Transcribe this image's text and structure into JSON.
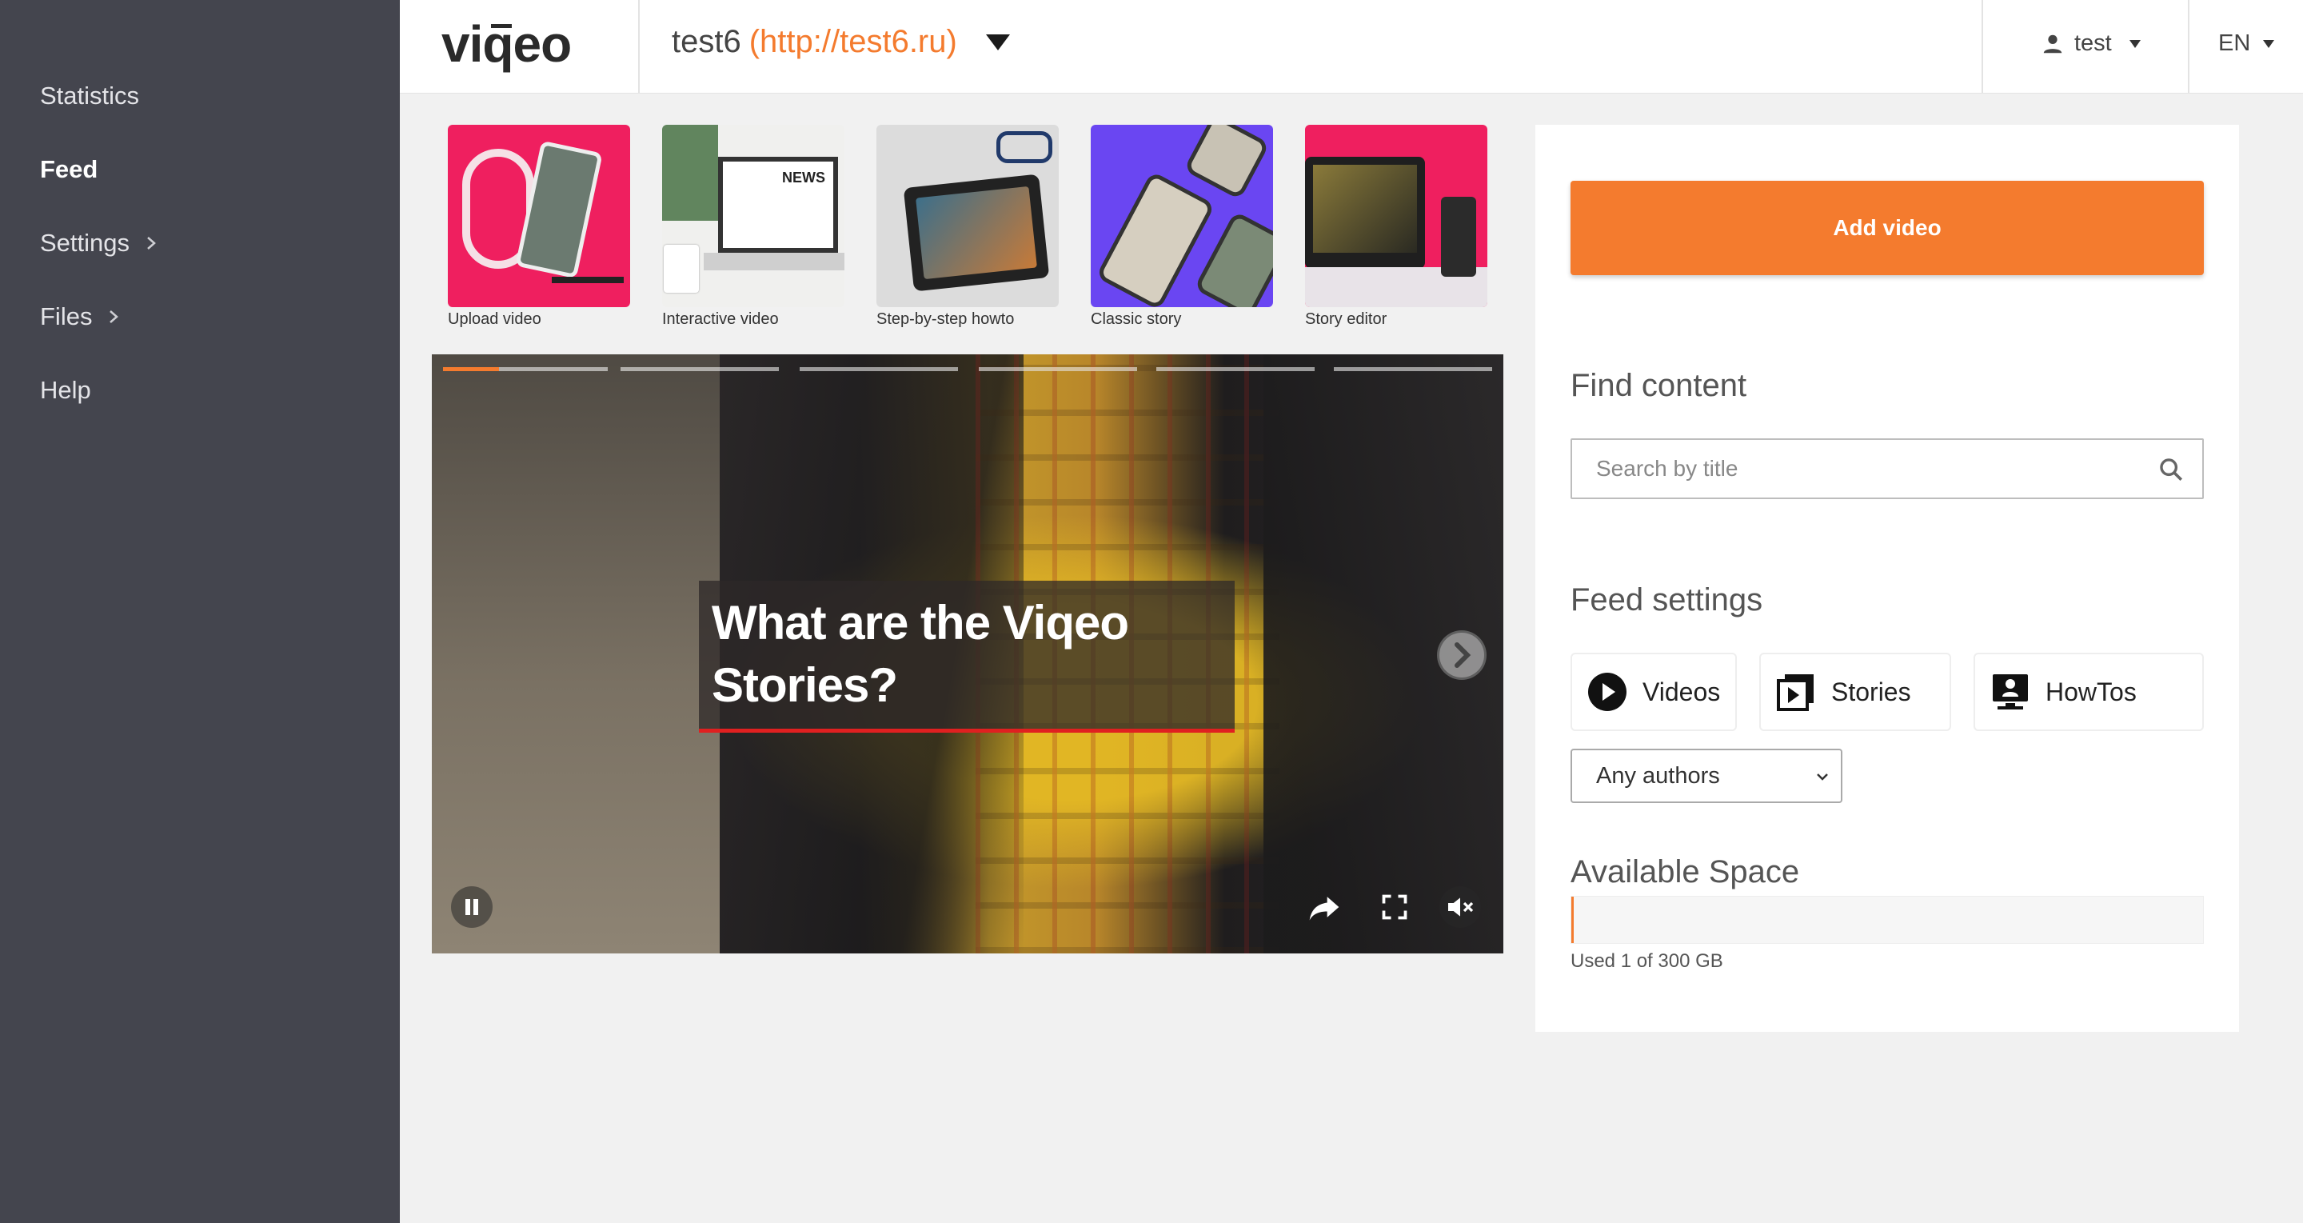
{
  "app": {
    "logo": "viqeo"
  },
  "sidebar": {
    "items": [
      {
        "label": "Statistics",
        "active": false,
        "has_submenu": false
      },
      {
        "label": "Feed",
        "active": true,
        "has_submenu": false
      },
      {
        "label": "Settings",
        "active": false,
        "has_submenu": true
      },
      {
        "label": "Files",
        "active": false,
        "has_submenu": true
      },
      {
        "label": "Help",
        "active": false,
        "has_submenu": false
      }
    ]
  },
  "header": {
    "site_name": "test6",
    "site_url": "(http://test6.ru)",
    "user": "test",
    "language": "EN"
  },
  "templates": [
    {
      "label": "Upload video"
    },
    {
      "label": "Interactive video"
    },
    {
      "label": "Step-by-step howto"
    },
    {
      "label": "Classic story"
    },
    {
      "label": "Story editor"
    }
  ],
  "player": {
    "title_line1": "What are the Viqeo",
    "title_line2": "Stories?",
    "segments": 6,
    "current_segment_progress": 0.34
  },
  "panel": {
    "add_video_label": "Add video",
    "find_content_title": "Find content",
    "search_placeholder": "Search by title",
    "feed_settings_title": "Feed settings",
    "feed_types": [
      {
        "label": "Videos",
        "icon": "play-circle-icon"
      },
      {
        "label": "Stories",
        "icon": "stories-icon"
      },
      {
        "label": "HowTos",
        "icon": "howto-icon"
      }
    ],
    "authors_selected": "Any authors",
    "available_space_title": "Available Space",
    "space_used_text": "Used 1 of 300 GB",
    "space_used_fraction": 0.0033
  },
  "colors": {
    "accent": "#f47b2e",
    "sidebar": "#44454e",
    "title_underline": "#e02020"
  }
}
